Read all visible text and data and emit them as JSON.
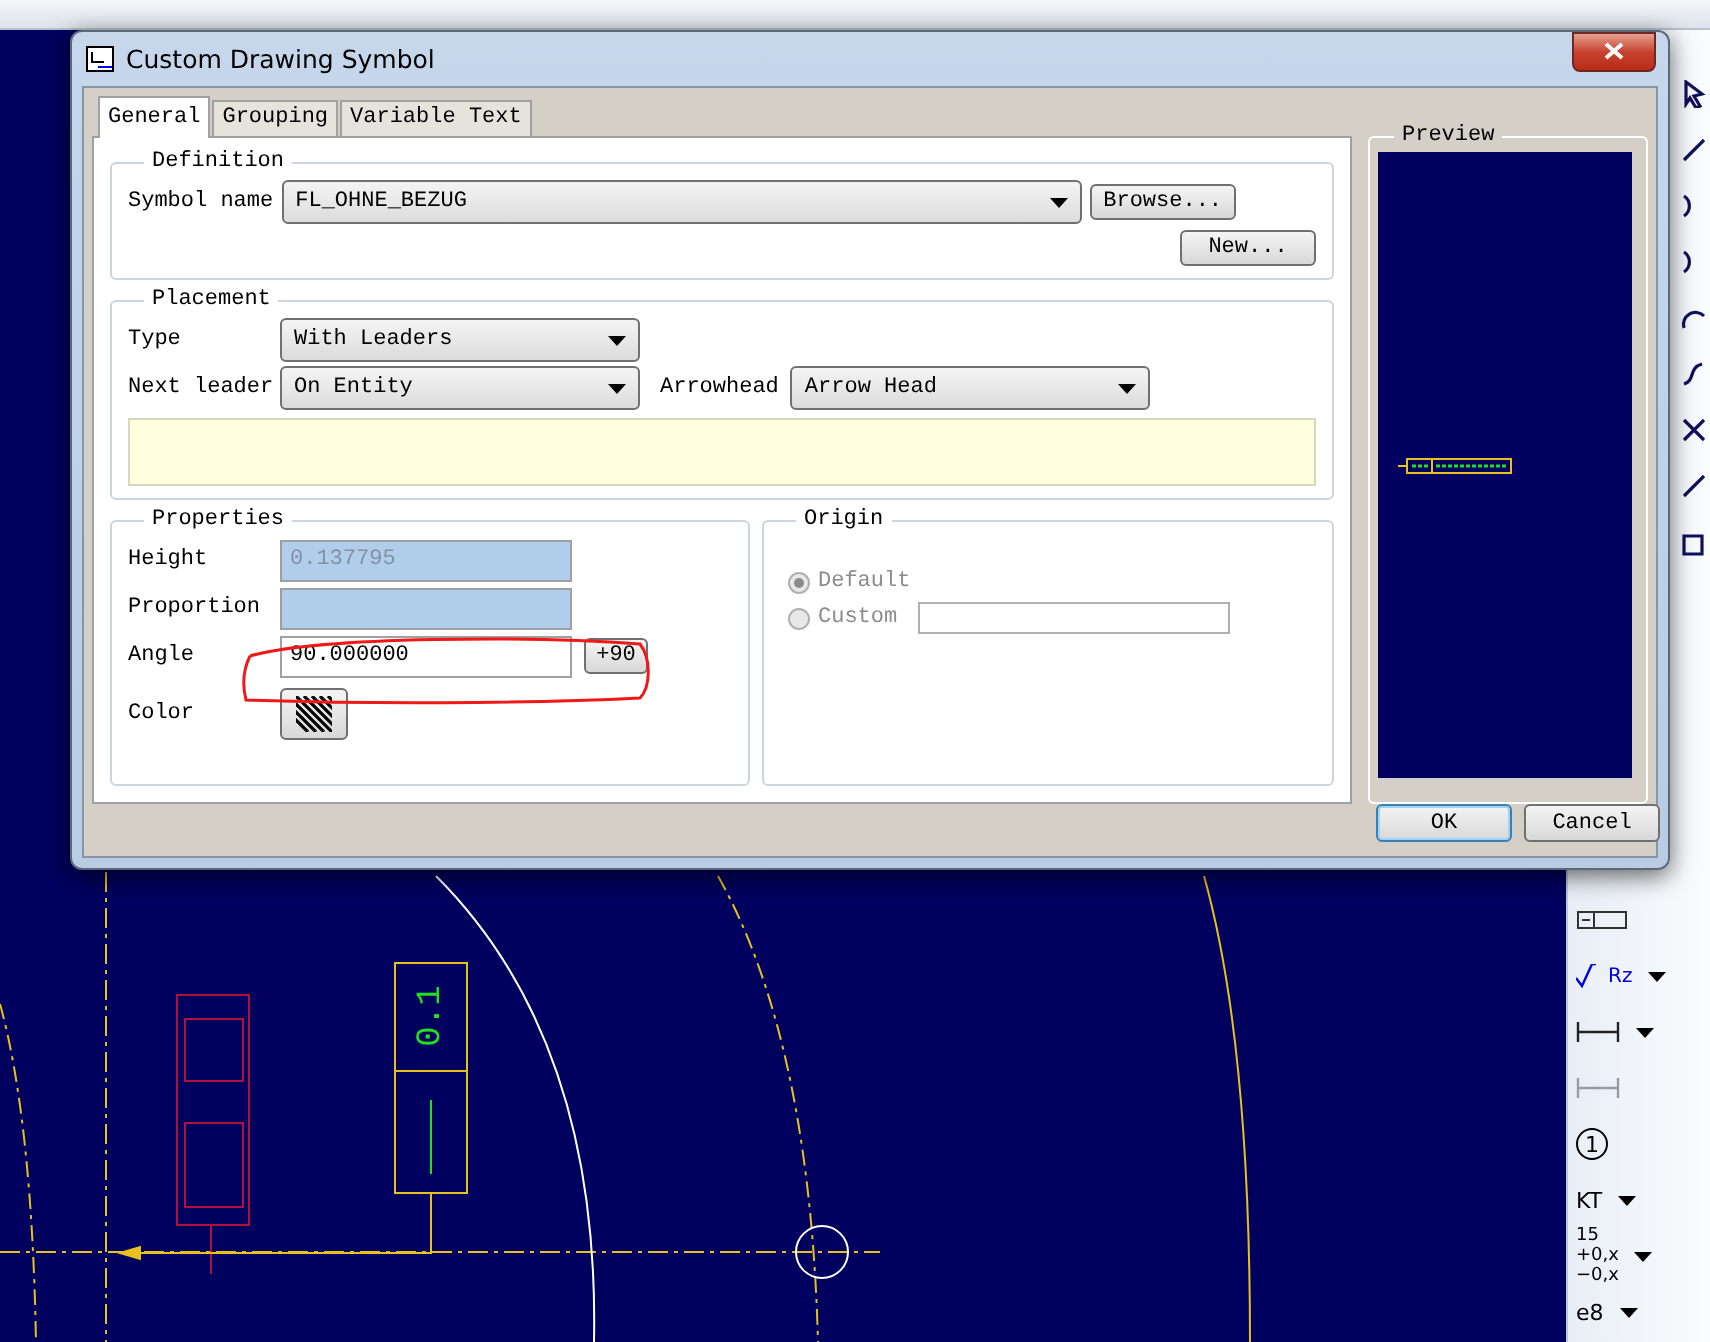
{
  "window": {
    "title": "Custom Drawing Symbol"
  },
  "tabs": [
    {
      "label": "General",
      "selected": true
    },
    {
      "label": "Grouping",
      "selected": false
    },
    {
      "label": "Variable Text",
      "selected": false
    }
  ],
  "definition": {
    "title": "Definition",
    "symbol_name": {
      "label": "Symbol name",
      "value": "FL_OHNE_BEZUG"
    },
    "buttons": [
      "Browse...",
      "New..."
    ]
  },
  "placement": {
    "title": "Placement",
    "type": {
      "label": "Type",
      "value": "With Leaders"
    },
    "next_leader": {
      "label": "Next leader",
      "value": "On Entity"
    },
    "arrowhead": {
      "label": "Arrowhead",
      "value": "Arrow Head"
    }
  },
  "properties": {
    "title": "Properties",
    "fields": [
      {
        "label": "Height",
        "value": "0.137795",
        "disabled": true
      },
      {
        "label": "Proportion",
        "disabled": true
      },
      {
        "label": "Angle",
        "value": "90.000000",
        "disabled": false,
        "button": "+90"
      }
    ],
    "color": {
      "label": "Color"
    }
  },
  "origin": {
    "title": "Origin",
    "options": [
      {
        "label": "Default",
        "selected": true,
        "disabled": true
      },
      {
        "label": "Custom",
        "selected": false,
        "disabled": true
      }
    ]
  },
  "preview": {
    "title": "Preview"
  },
  "buttons": [
    "OK",
    "Cancel"
  ],
  "drawing": {
    "symbol_text": "0.1"
  },
  "toolbar": [
    {
      "kind": "frame",
      "menu": false,
      "disabled": false
    },
    {
      "kind": "roughness",
      "label": "Rz",
      "menu": true,
      "disabled": false
    },
    {
      "kind": "dimension",
      "menu": true,
      "disabled": false
    },
    {
      "kind": "dimension",
      "menu": false,
      "disabled": true
    },
    {
      "kind": "balloon",
      "label": "1",
      "menu": false,
      "disabled": false
    },
    {
      "kind": "text-style",
      "label": "KT",
      "menu": true,
      "disabled": false
    },
    {
      "kind": "tolerance",
      "label": "15",
      "upper": "+0,x",
      "lower": "−0,x",
      "menu": true,
      "disabled": false
    },
    {
      "kind": "fit",
      "label": "e8",
      "menu": true,
      "disabled": false
    }
  ]
}
